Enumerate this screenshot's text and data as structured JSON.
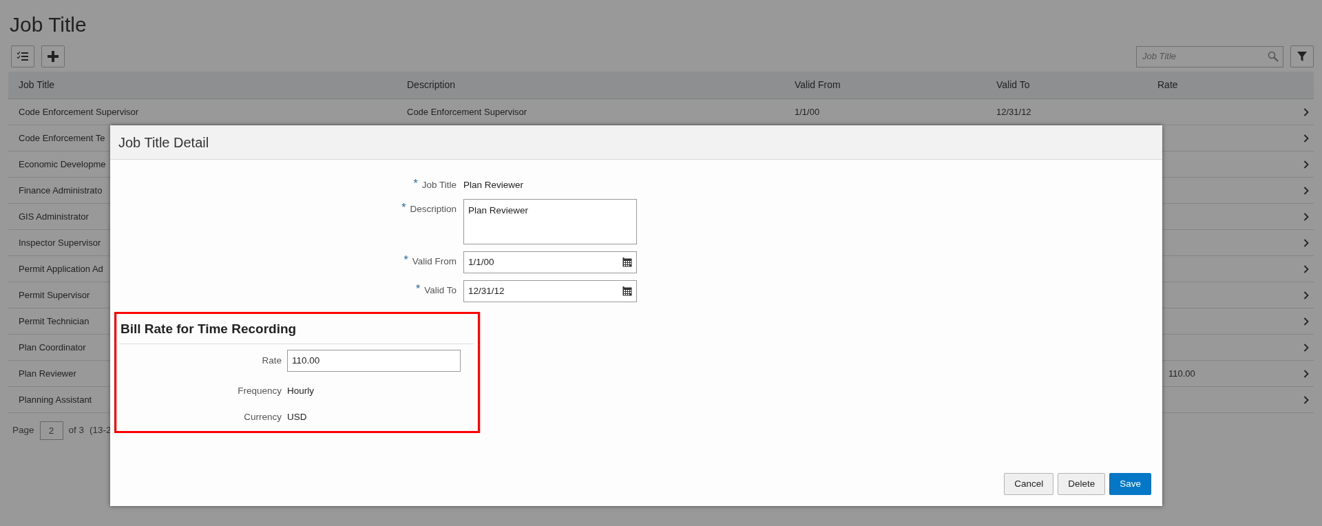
{
  "page_title": "Job Title",
  "search": {
    "placeholder": "Job Title"
  },
  "table": {
    "columns": [
      "Job Title",
      "Description",
      "Valid From",
      "Valid To",
      "Rate"
    ],
    "rows": [
      {
        "job_title": "Code Enforcement Supervisor",
        "description": "Code Enforcement Supervisor",
        "valid_from": "1/1/00",
        "valid_to": "12/31/12"
      },
      {
        "job_title": "Code Enforcement Te"
      },
      {
        "job_title": "Economic Developme"
      },
      {
        "job_title": "Finance Administrato"
      },
      {
        "job_title": "GIS Administrator"
      },
      {
        "job_title": "Inspector Supervisor"
      },
      {
        "job_title": "Permit Application Ad"
      },
      {
        "job_title": "Permit Supervisor"
      },
      {
        "job_title": "Permit Technician"
      },
      {
        "job_title": "Plan Coordinator"
      },
      {
        "job_title": "Plan Reviewer",
        "rate": "110.00"
      },
      {
        "job_title": "Planning Assistant"
      }
    ]
  },
  "pagination": {
    "label": "Page",
    "page": "2",
    "of": "of 3",
    "range": "(13-2"
  },
  "dialog": {
    "title": "Job Title Detail",
    "fields": [
      {
        "kind": "text",
        "required_mark": "*",
        "label": "Job Title",
        "value": "Plan Reviewer"
      },
      {
        "kind": "textarea",
        "required_mark": "*",
        "label": "Description",
        "value": "Plan Reviewer"
      },
      {
        "kind": "date",
        "required_mark": "*",
        "label": "Valid From",
        "value": "1/1/00"
      },
      {
        "kind": "date",
        "required_mark": "*",
        "label": "Valid To",
        "value": "12/31/12"
      }
    ],
    "section": {
      "title": "Bill Rate for Time Recording",
      "fields": [
        {
          "kind": "input",
          "label": "Rate",
          "value": "110.00"
        },
        {
          "kind": "text",
          "label": "Frequency",
          "value": "Hourly"
        },
        {
          "kind": "text",
          "label": "Currency",
          "value": "USD"
        }
      ]
    },
    "buttons": [
      {
        "label": "Cancel",
        "kind": "secondary"
      },
      {
        "label": "Delete",
        "kind": "secondary"
      },
      {
        "label": "Save",
        "kind": "primary"
      }
    ]
  }
}
